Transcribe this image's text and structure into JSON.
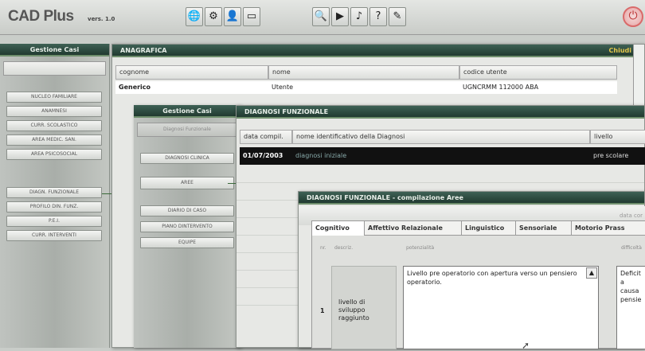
{
  "app": {
    "name": "CAD Plus",
    "version": "vers. 1.0"
  },
  "toolbar": {
    "left_icons": [
      "globe-icon",
      "network-icon",
      "user-icon",
      "window-icon"
    ],
    "right_icons": [
      "search-icon",
      "video-icon",
      "audio-icon",
      "help-icon",
      "notes-icon"
    ],
    "power_icon": "power-icon"
  },
  "sidebar1": {
    "title": "Gestione Casi",
    "items": [
      "NUCLEO FAMILIARE",
      "ANAMNESI",
      "CURR. SCOLASTICO",
      "AREA MEDIC. SAN.",
      "AREA PSICOSOCIAL",
      "DIAGN. FUNZIONALE",
      "PROFILO DIN. FUNZ.",
      "P.E.I.",
      "CURR. INTERVENTI"
    ]
  },
  "anagrafica": {
    "title": "ANAGRAFICA",
    "close": "Chiudi",
    "columns": [
      "cognome",
      "nome",
      "codice utente"
    ],
    "row": [
      "Generico",
      "Utente",
      "UGNCRMM 112000 ABA"
    ]
  },
  "sidebar2": {
    "title": "Gestione Casi",
    "items": [
      "Diagnosi Funzionale",
      "DIAGNOSI CLINICA",
      "AREE",
      "DIARIO DI CASO",
      "PIANO DINTERVENTO",
      "EQUIPE"
    ]
  },
  "diagnosi": {
    "title": "DIAGNOSI FUNZIONALE",
    "columns": [
      "data compil.",
      "nome identificativo della Diagnosi",
      "livello"
    ],
    "row": [
      "01/07/2003",
      "diagnosi iniziale",
      "pre scolare"
    ]
  },
  "aree": {
    "title": "DIAGNOSI FUNZIONALE - compilazione Aree",
    "subheader": "data cor",
    "tabs": [
      "Cognitivo",
      "Affettivo Relazionale",
      "Linguistico",
      "Sensoriale",
      "Motorio Prass"
    ],
    "col_num": "nr.",
    "col_descr": "descriz.",
    "col_potenz": "potenzialità",
    "col_diff": "difficoltà",
    "row_num": "1",
    "row_label": "livello di sviluppo raggiunto",
    "potenzialita_text": "Livello pre operatorio con apertura verso un pensiero operatorio.",
    "difficolta_text": "Deficit a causa pensie"
  }
}
